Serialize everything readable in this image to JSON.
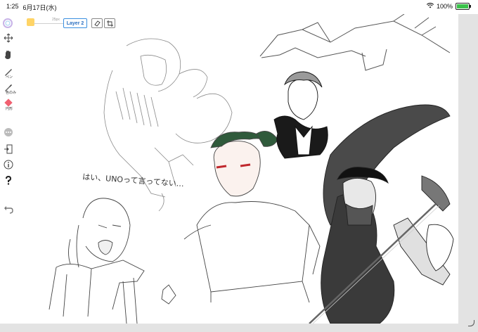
{
  "status": {
    "time": "1:25",
    "date": "6月17日(水)",
    "battery": "100%",
    "battery_level": 1.0
  },
  "toolbar": {
    "brush_size": "25px",
    "layer_label": "Layer 2"
  },
  "tools": {
    "pen_label": "ペン",
    "eyedropper_label": "色のみ",
    "color_label": "円形"
  },
  "colors": {
    "accent": "#3a8fe0",
    "color_swatch": "#ffd466",
    "current_color": "#f06070",
    "battery": "#3ac24a"
  },
  "canvas": {
    "handwriting": "はい、UNOって言ってない…"
  }
}
